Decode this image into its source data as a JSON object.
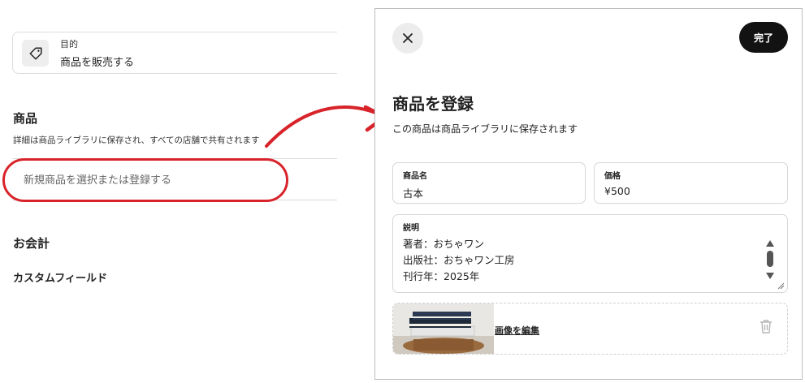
{
  "purpose": {
    "label": "目的",
    "value": "商品を販売する",
    "icon": "tag-icon"
  },
  "products": {
    "title": "商品",
    "description": "詳細は商品ライブラリに保存され、すべての店舗で共有されます",
    "select_placeholder": "新規商品を選択または登録する"
  },
  "payment": {
    "title": "お会計"
  },
  "custom_fields": {
    "label": "カスタムフィールド"
  },
  "modal": {
    "close_icon": "close-icon",
    "done_label": "完了",
    "title": "商品を登録",
    "subtitle": "この商品は商品ライブラリに保存されます",
    "name_field": {
      "label": "商品名",
      "value": "古本"
    },
    "price_field": {
      "label": "価格",
      "value": "¥500"
    },
    "description_field": {
      "label": "説明",
      "lines": [
        "著者：おちゃワン",
        "出版社：おちゃワン工房",
        "刊行年：2025年"
      ]
    },
    "image": {
      "edit_label": "画像を編集",
      "delete_icon": "trash-icon"
    }
  },
  "annotation": {
    "highlight_color": "#d8232a"
  }
}
